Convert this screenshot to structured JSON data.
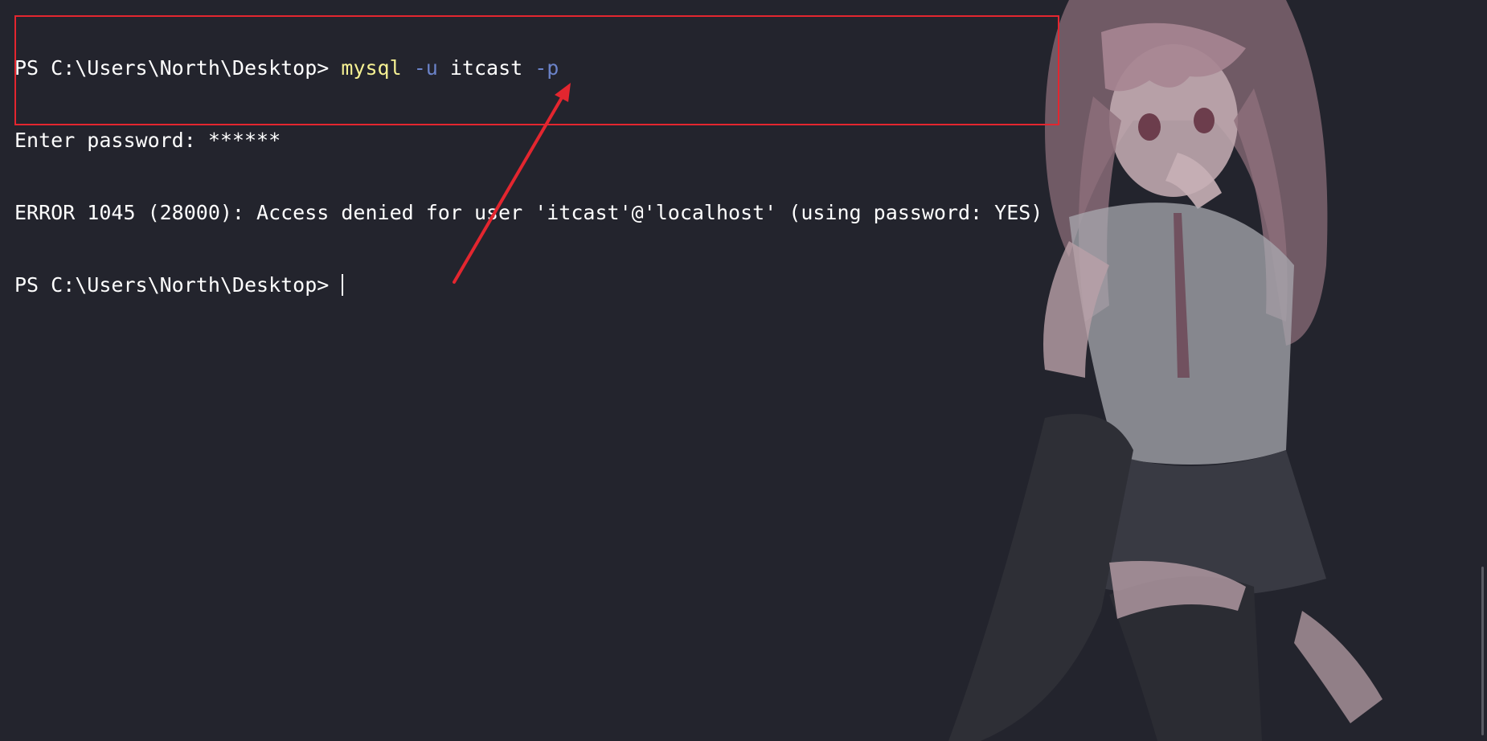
{
  "terminal": {
    "lines": [
      {
        "prompt": "PS C:\\Users\\North\\Desktop> ",
        "exe": "mysql",
        "flag_u": " -u",
        "user": " itcast",
        "flag_p": " -p"
      },
      {
        "text": "Enter password: ******"
      },
      {
        "text": "ERROR 1045 (28000): Access denied for user 'itcast'@'localhost' (using password: YES)"
      },
      {
        "prompt": "PS C:\\Users\\North\\Desktop> "
      }
    ]
  },
  "colors": {
    "background": "#23242d",
    "text": "#ffffff",
    "command": "#f6f193",
    "parameter": "#6b83c9",
    "annotation": "#e3262f"
  },
  "background_image": {
    "icon": "anime-girl-wallpaper"
  }
}
